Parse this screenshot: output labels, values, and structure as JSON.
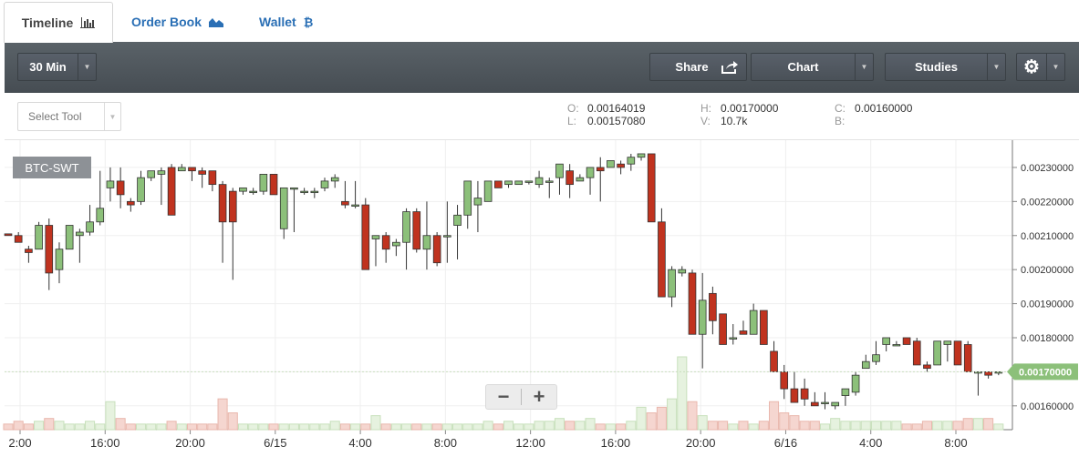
{
  "tabs": [
    {
      "label": "Timeline",
      "icon": "bar-chart-icon",
      "active": true
    },
    {
      "label": "Order Book",
      "icon": "area-chart-icon",
      "active": false
    },
    {
      "label": "Wallet",
      "icon": "bitcoin-icon",
      "active": false
    }
  ],
  "toolbar": {
    "interval": "30 Min",
    "share": "Share",
    "chart": "Chart",
    "studies": "Studies"
  },
  "select_tool": {
    "label": "Select Tool"
  },
  "ohlc": {
    "o": {
      "key": "O:",
      "value": "0.00164019"
    },
    "l": {
      "key": "L:",
      "value": "0.00157080"
    },
    "h": {
      "key": "H:",
      "value": "0.00170000"
    },
    "v": {
      "key": "V:",
      "value": "10.7k"
    },
    "c": {
      "key": "C:",
      "value": "0.00160000"
    },
    "b": {
      "key": "B:",
      "value": ""
    }
  },
  "symbol": "BTC-SWT",
  "colors": {
    "up": "#8cc07a",
    "down": "#c0331f",
    "last": "#8cc07a",
    "toolbar": "#4f565c",
    "tab_link": "#2a6fb5"
  },
  "chart_data": {
    "type": "candlestick",
    "y_ticks": [
      "0.00160000",
      "0.00170000",
      "0.00180000",
      "0.00190000",
      "0.00200000",
      "0.00210000",
      "0.00220000",
      "0.00230000"
    ],
    "ylim": [
      0.00153,
      0.00238
    ],
    "x_ticks": [
      "2:00",
      "16:00",
      "20:00",
      "6/15",
      "4:00",
      "8:00",
      "12:00",
      "16:00",
      "20:00",
      "6/16",
      "4:00",
      "8:00"
    ],
    "last_price": "0.00170000",
    "grid": true,
    "candles": [
      [
        0.002105,
        0.002105,
        0.0021,
        0.0021,
        2
      ],
      [
        0.0021,
        0.00211,
        0.00208,
        0.00208,
        3
      ],
      [
        0.00206,
        0.00207,
        0.00202,
        0.00205,
        2
      ],
      [
        0.00206,
        0.00214,
        0.00206,
        0.00213,
        3
      ],
      [
        0.00213,
        0.00215,
        0.00194,
        0.00199,
        4
      ],
      [
        0.002,
        0.00208,
        0.00196,
        0.00206,
        3
      ],
      [
        0.00206,
        0.00213,
        0.00206,
        0.00213,
        2
      ],
      [
        0.0021,
        0.00212,
        0.00202,
        0.00211,
        2
      ],
      [
        0.00211,
        0.00219,
        0.0021,
        0.00214,
        3
      ],
      [
        0.00214,
        0.00229,
        0.00213,
        0.00218,
        2
      ],
      [
        0.00224,
        0.0023,
        0.0022,
        0.00226,
        10
      ],
      [
        0.00226,
        0.0023,
        0.00218,
        0.00222,
        4
      ],
      [
        0.0022,
        0.00221,
        0.00217,
        0.00219,
        2
      ],
      [
        0.0022,
        0.00229,
        0.00219,
        0.00227,
        2
      ],
      [
        0.00227,
        0.00229,
        0.00226,
        0.00229,
        2
      ],
      [
        0.00228,
        0.0023,
        0.00219,
        0.00229,
        2
      ],
      [
        0.0023,
        0.00231,
        0.00216,
        0.00216,
        3
      ],
      [
        0.00229,
        0.00231,
        0.00229,
        0.0023,
        2
      ],
      [
        0.0023,
        0.0023,
        0.00226,
        0.00229,
        2
      ],
      [
        0.00229,
        0.0023,
        0.00224,
        0.00228,
        2
      ],
      [
        0.00229,
        0.00229,
        0.00223,
        0.00225,
        2
      ],
      [
        0.00225,
        0.00226,
        0.00202,
        0.00214,
        11
      ],
      [
        0.00223,
        0.00224,
        0.00197,
        0.00214,
        6
      ],
      [
        0.00223,
        0.00224,
        0.00222,
        0.00224,
        2
      ],
      [
        0.00223,
        0.00224,
        0.00222,
        0.00223,
        2
      ],
      [
        0.00223,
        0.00228,
        0.00222,
        0.00228,
        2
      ],
      [
        0.00228,
        0.00228,
        0.00222,
        0.00222,
        2
      ],
      [
        0.00212,
        0.00223,
        0.00209,
        0.00224,
        2
      ],
      [
        0.00224,
        0.00224,
        0.00211,
        0.00224,
        2
      ],
      [
        0.00223,
        0.00224,
        0.00222,
        0.00223,
        2
      ],
      [
        0.00223,
        0.00224,
        0.00221,
        0.00223,
        2
      ],
      [
        0.00224,
        0.00227,
        0.00223,
        0.00226,
        2
      ],
      [
        0.00226,
        0.00228,
        0.00224,
        0.00227,
        3
      ],
      [
        0.0022,
        0.00226,
        0.00218,
        0.00219,
        2
      ],
      [
        0.00219,
        0.00226,
        0.00218,
        0.00219,
        2
      ],
      [
        0.00219,
        0.00221,
        0.002,
        0.002,
        2
      ],
      [
        0.00209,
        0.0021,
        0.00201,
        0.0021,
        5
      ],
      [
        0.0021,
        0.00211,
        0.00202,
        0.00206,
        2
      ],
      [
        0.00207,
        0.00209,
        0.00204,
        0.00208,
        2
      ],
      [
        0.00208,
        0.00218,
        0.002,
        0.00217,
        2
      ],
      [
        0.00217,
        0.00218,
        0.00205,
        0.00206,
        2
      ],
      [
        0.00206,
        0.0022,
        0.002,
        0.0021,
        2
      ],
      [
        0.0021,
        0.00211,
        0.00201,
        0.00202,
        2
      ],
      [
        0.0021,
        0.0022,
        0.00202,
        0.0021,
        2
      ],
      [
        0.00213,
        0.00219,
        0.00203,
        0.00216,
        2
      ],
      [
        0.00216,
        0.00226,
        0.00212,
        0.00226,
        2
      ],
      [
        0.00219,
        0.00226,
        0.00211,
        0.00221,
        2
      ],
      [
        0.0022,
        0.00226,
        0.0022,
        0.00226,
        3
      ],
      [
        0.00226,
        0.00226,
        0.00224,
        0.00224,
        2
      ],
      [
        0.00225,
        0.00226,
        0.00224,
        0.00226,
        3
      ],
      [
        0.00225,
        0.00226,
        0.00225,
        0.00226,
        2
      ],
      [
        0.00226,
        0.00226,
        0.00225,
        0.00226,
        2
      ],
      [
        0.00225,
        0.00229,
        0.00224,
        0.00227,
        3
      ],
      [
        0.00226,
        0.00227,
        0.00221,
        0.00226,
        3
      ],
      [
        0.00227,
        0.00229,
        0.00222,
        0.00231,
        4
      ],
      [
        0.00229,
        0.00231,
        0.00221,
        0.00225,
        3
      ],
      [
        0.00226,
        0.00228,
        0.00226,
        0.00227,
        3
      ],
      [
        0.00227,
        0.00229,
        0.00222,
        0.0023,
        4
      ],
      [
        0.0023,
        0.00233,
        0.0022,
        0.00229,
        2
      ],
      [
        0.0023,
        0.00232,
        0.0023,
        0.00232,
        2
      ],
      [
        0.00231,
        0.00232,
        0.00228,
        0.0023,
        2
      ],
      [
        0.00231,
        0.00234,
        0.00229,
        0.00233,
        3
      ],
      [
        0.00233,
        0.00234,
        0.00232,
        0.00234,
        8
      ],
      [
        0.00234,
        0.00234,
        0.00214,
        0.00214,
        6
      ],
      [
        0.00214,
        0.00218,
        0.00192,
        0.00192,
        8
      ],
      [
        0.00192,
        0.00201,
        0.00189,
        0.002,
        11
      ],
      [
        0.00199,
        0.00201,
        0.00198,
        0.002,
        26
      ],
      [
        0.00199,
        0.002,
        0.00181,
        0.00181,
        10
      ],
      [
        0.00181,
        0.00199,
        0.00171,
        0.00191,
        5
      ],
      [
        0.00193,
        0.00195,
        0.00181,
        0.00185,
        3
      ],
      [
        0.00187,
        0.00187,
        0.00178,
        0.00178,
        3
      ],
      [
        0.0018,
        0.00184,
        0.00178,
        0.0018,
        2
      ],
      [
        0.00182,
        0.00185,
        0.00181,
        0.00181,
        3
      ],
      [
        0.00181,
        0.0019,
        0.00181,
        0.00188,
        2
      ],
      [
        0.00188,
        0.00188,
        0.00178,
        0.00178,
        3
      ],
      [
        0.00176,
        0.00179,
        0.0017,
        0.0017,
        10
      ],
      [
        0.0017,
        0.00172,
        0.00162,
        0.00165,
        6
      ],
      [
        0.00165,
        0.0017,
        0.00162,
        0.00161,
        5
      ],
      [
        0.00165,
        0.00168,
        0.0016,
        0.00162,
        3
      ],
      [
        0.00161,
        0.00164,
        0.0016,
        0.0016,
        3
      ],
      [
        0.00161,
        0.00164,
        0.00159,
        0.00161,
        2
      ],
      [
        0.0016,
        0.00161,
        0.00159,
        0.00161,
        4
      ],
      [
        0.00163,
        0.00164,
        0.0016,
        0.00165,
        3
      ],
      [
        0.00164,
        0.0017,
        0.00163,
        0.00169,
        3
      ],
      [
        0.00171,
        0.00175,
        0.00171,
        0.00173,
        3
      ],
      [
        0.00173,
        0.00179,
        0.00172,
        0.00175,
        3
      ],
      [
        0.00178,
        0.0018,
        0.00176,
        0.0018,
        3
      ],
      [
        0.00178,
        0.00179,
        0.00178,
        0.00178,
        3
      ],
      [
        0.0018,
        0.0018,
        0.00178,
        0.00178,
        2
      ],
      [
        0.00179,
        0.0018,
        0.00172,
        0.00172,
        2
      ],
      [
        0.00172,
        0.00173,
        0.0017,
        0.00171,
        3
      ],
      [
        0.00172,
        0.00178,
        0.00172,
        0.00179,
        3
      ],
      [
        0.00178,
        0.00179,
        0.00173,
        0.00179,
        3
      ],
      [
        0.00179,
        0.00179,
        0.00172,
        0.00172,
        3
      ],
      [
        0.00178,
        0.00179,
        0.0017,
        0.0017,
        4
      ],
      [
        0.0017,
        0.0017,
        0.00163,
        0.0017,
        4
      ],
      [
        0.0017,
        0.0017,
        0.00168,
        0.00169,
        4
      ],
      [
        0.0017,
        0.0017,
        0.00169,
        0.0017,
        2
      ]
    ]
  }
}
